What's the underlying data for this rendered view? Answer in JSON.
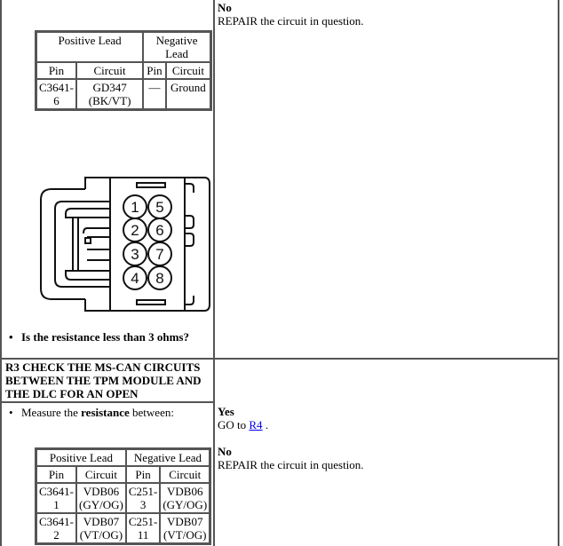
{
  "step_r2_continued": {
    "no_label": "No",
    "no_text": "REPAIR the circuit in question.",
    "table": {
      "header_positive": "Positive Lead",
      "header_negative": "Negative Lead",
      "col_pin": "Pin",
      "col_circuit": "Circuit",
      "rows": [
        {
          "pos_pin": "C3641-6",
          "pos_circuit": "GD347 (BK/VT)",
          "neg_pin": "—",
          "neg_circuit": "Ground"
        }
      ]
    },
    "connector_pins": [
      "1",
      "2",
      "3",
      "4",
      "5",
      "6",
      "7",
      "8"
    ],
    "question": "Is the resistance less than 3 ohms?"
  },
  "step_r3": {
    "heading": "R3 CHECK THE MS-CAN CIRCUITS BETWEEN THE TPM MODULE AND THE DLC FOR AN OPEN",
    "instruction_prefix": "Measure the ",
    "instruction_bold": "resistance",
    "instruction_suffix": " between:",
    "yes_label": "Yes",
    "yes_text_prefix": "GO to ",
    "yes_link": "R4",
    "yes_text_suffix": " .",
    "no_label": "No",
    "no_text": "REPAIR the circuit in question.",
    "table": {
      "header_positive": "Positive Lead",
      "header_negative": "Negative Lead",
      "col_pin": "Pin",
      "col_circuit": "Circuit",
      "rows": [
        {
          "pos_pin": "C3641-1",
          "pos_circuit": "VDB06 (GY/OG)",
          "neg_pin": "C251-3",
          "neg_circuit": "VDB06 (GY/OG)"
        },
        {
          "pos_pin": "C3641-2",
          "pos_circuit": "VDB07 (VT/OG)",
          "neg_pin": "C251-11",
          "neg_circuit": "VDB07 (VT/OG)"
        }
      ]
    }
  }
}
